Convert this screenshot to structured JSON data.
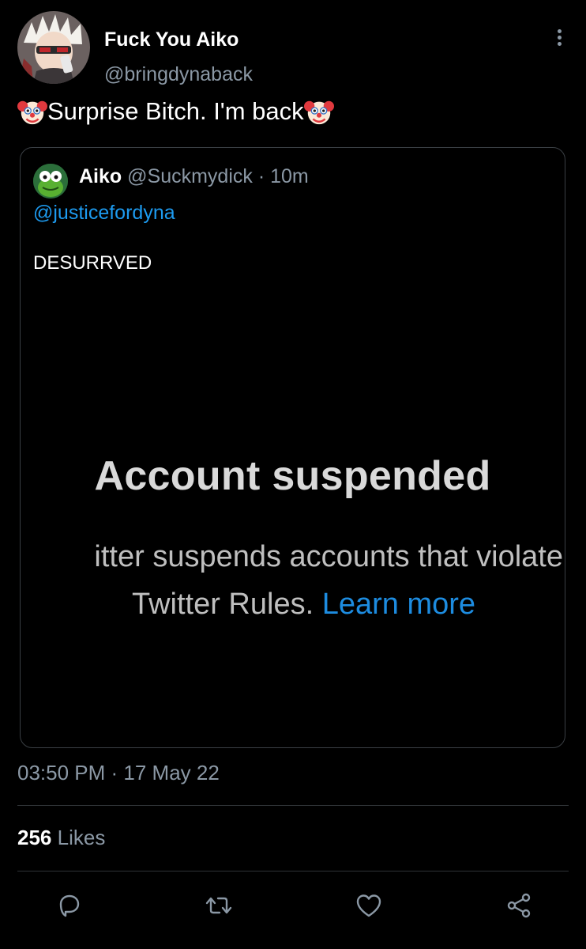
{
  "author": {
    "name": "Fuck You Aiko",
    "handle": "@bringdynaback"
  },
  "tweet": {
    "text": "Surprise Bitch. I'm back",
    "prefix_emoji": "clown-face",
    "suffix_emoji": "clown-face"
  },
  "quote": {
    "name": "Aiko",
    "handle": "@Suckmydick",
    "time": "· 10m",
    "mention": "@justicefordyna",
    "text": "DESURRVED",
    "image": {
      "title": "Account suspended",
      "line1": "itter suspends accounts that violate",
      "line2": "Twitter Rules.",
      "link": "Learn more"
    }
  },
  "meta": {
    "timestamp": "03:50 PM · 17 May 22",
    "likes_count": "256",
    "likes_label": "Likes"
  },
  "icons": {
    "reply": "reply-icon",
    "retweet": "retweet-icon",
    "like": "heart-icon",
    "share": "share-icon",
    "more": "more-vertical-icon"
  },
  "colors": {
    "background": "#000000",
    "text": "#ffffff",
    "muted": "#8b98a5",
    "accent": "#1d9bf0",
    "border": "#3a3f44"
  }
}
